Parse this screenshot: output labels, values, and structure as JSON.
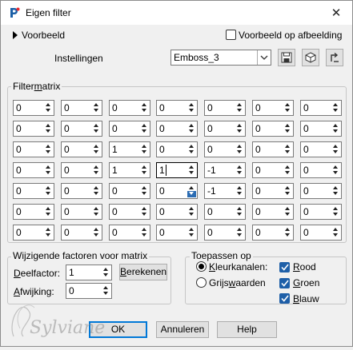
{
  "window": {
    "title": "Eigen filter",
    "icon": "paintshop-pro-icon",
    "close_glyph": "✕"
  },
  "preview": {
    "toggle_label": "Voorbeeld",
    "checkbox_label": "Voorbeeld op afbeelding",
    "checkbox_checked": false
  },
  "settings": {
    "label": "Instellingen",
    "value": "Emboss_3"
  },
  "matrix": {
    "title": "Filtermatrix",
    "rows": [
      [
        "0",
        "0",
        "0",
        "0",
        "0",
        "0",
        "0"
      ],
      [
        "0",
        "0",
        "0",
        "0",
        "0",
        "0",
        "0"
      ],
      [
        "0",
        "0",
        "1",
        "0",
        "0",
        "0",
        "0"
      ],
      [
        "0",
        "0",
        "1",
        "1",
        "-1",
        "0",
        "0"
      ],
      [
        "0",
        "0",
        "0",
        "0",
        "-1",
        "0",
        "0"
      ],
      [
        "0",
        "0",
        "0",
        "0",
        "0",
        "0",
        "0"
      ],
      [
        "0",
        "0",
        "0",
        "0",
        "0",
        "0",
        "0"
      ]
    ]
  },
  "factors": {
    "title": "Wijzigende factoren voor matrix",
    "divisor_label": "Deelfactor:",
    "divisor_value": "1",
    "compute_label": "Berekenen",
    "bias_label": "Afwijking:",
    "bias_value": "0"
  },
  "apply": {
    "title": "Toepassen op",
    "color_channels": "Kleurkanalen:",
    "grayscale": "Grijswaarden",
    "red": "Rood",
    "green": "Groen",
    "blue": "Blauw"
  },
  "buttons": {
    "ok": "OK",
    "cancel": "Annuleren",
    "help": "Help"
  },
  "watermark": "Sylviane",
  "colors": {
    "accent": "#0078d7",
    "checkbox_fill": "#1e5fa8"
  }
}
